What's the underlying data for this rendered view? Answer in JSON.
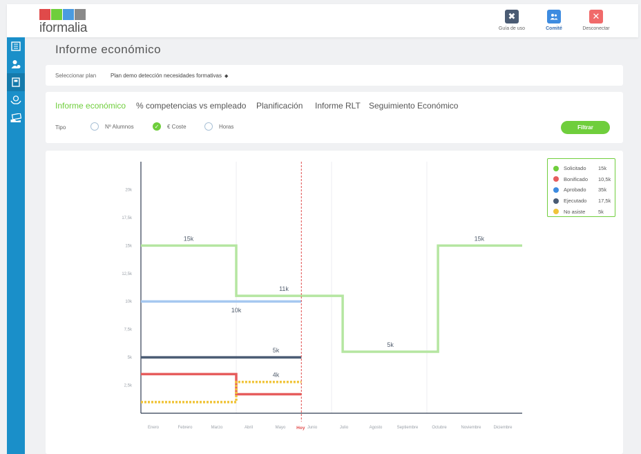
{
  "app": {
    "logo_text": "iformalia",
    "logo_colors": [
      "#e04a4a",
      "#6fce3c",
      "#4a9be0",
      "#8a8a8a"
    ]
  },
  "topbar": {
    "actions": [
      {
        "label": "Guía de uso",
        "icon": "tools-icon",
        "color": "#4a5b73"
      },
      {
        "label": "Comité",
        "icon": "users-icon",
        "color": "#3d8be0"
      },
      {
        "label": "Desconectar",
        "icon": "close-icon",
        "color": "#f06a6a"
      }
    ]
  },
  "sidebar": {
    "items": [
      "report-list-icon",
      "user-add-icon",
      "book-icon",
      "help-hands-icon",
      "money-hand-icon"
    ]
  },
  "page": {
    "title": "Informe económico"
  },
  "plan": {
    "label": "Seleccionar plan",
    "selected": "Plan demo detección necesidades formativas"
  },
  "tabs": [
    "Informe económico",
    "% competencias vs empleado",
    "Planificación",
    "Informe RLT",
    "Seguimiento Económico"
  ],
  "filters": {
    "tipo_label": "Tipo",
    "options": [
      {
        "label": "Nº Alumnos",
        "checked": false
      },
      {
        "label": "€ Coste",
        "checked": true
      },
      {
        "label": "Horas",
        "checked": false
      }
    ],
    "button": "Filtrar"
  },
  "chart_data": {
    "type": "line",
    "step": true,
    "x": [
      "Enero",
      "Febrero",
      "Marzo",
      "Abril",
      "Mayo",
      "Junio",
      "Julio",
      "Agosto",
      "Septiembre",
      "Octubre",
      "Noviembre",
      "Diciembre"
    ],
    "y_ticks": [
      "2,5k",
      "5k",
      "7,5k",
      "10k",
      "12,5k",
      "15k",
      "17,5k",
      "20k"
    ],
    "ylim": [
      0,
      22500
    ],
    "today_marker": {
      "label": "Hoy"
    },
    "grid": true,
    "legend_position": "top-right",
    "series": [
      {
        "name": "Solicitado",
        "total": "15k",
        "color": "#b5e6a1",
        "legend_color": "#6fce3c",
        "dashed": false,
        "segments": [
          [
            0,
            3,
            15000
          ],
          [
            3,
            6.35,
            10500
          ],
          [
            6.35,
            9.35,
            5500
          ],
          [
            9.35,
            12,
            15000
          ]
        ]
      },
      {
        "name": "Bonificado",
        "total": "10,5k",
        "color": "#e65d5d",
        "legend_color": "#e65d5d",
        "dashed": false,
        "segments": [
          [
            0,
            3,
            3500
          ],
          [
            3,
            5.05,
            1700
          ]
        ]
      },
      {
        "name": "Aprobado",
        "total": "35k",
        "color": "#a6c8f0",
        "legend_color": "#3d8be0",
        "dashed": false,
        "segments": [
          [
            0,
            5.05,
            10000
          ]
        ]
      },
      {
        "name": "Ejecutado",
        "total": "17,5k",
        "color": "#4a5b73",
        "legend_color": "#4a5b73",
        "dashed": false,
        "segments": [
          [
            0,
            5.05,
            5000
          ]
        ]
      },
      {
        "name": "No asiste",
        "total": "5k",
        "color": "#f0c43a",
        "legend_color": "#f0c43a",
        "dashed": true,
        "segments": [
          [
            0,
            3,
            1000
          ],
          [
            3,
            5.05,
            2800
          ]
        ]
      }
    ],
    "data_labels": [
      {
        "text": "15k",
        "x": 1.5,
        "y": 15000,
        "pos": "above"
      },
      {
        "text": "11k",
        "x": 4.5,
        "y": 10500,
        "pos": "above"
      },
      {
        "text": "10k",
        "x": 3,
        "y": 10000,
        "pos": "below"
      },
      {
        "text": "5k",
        "x": 4.25,
        "y": 5000,
        "pos": "above"
      },
      {
        "text": "4k",
        "x": 4.25,
        "y": 2800,
        "pos": "above"
      },
      {
        "text": "5k",
        "x": 7.85,
        "y": 5500,
        "pos": "above"
      },
      {
        "text": "15k",
        "x": 10.65,
        "y": 15000,
        "pos": "above"
      }
    ],
    "today_x": 5.05
  }
}
